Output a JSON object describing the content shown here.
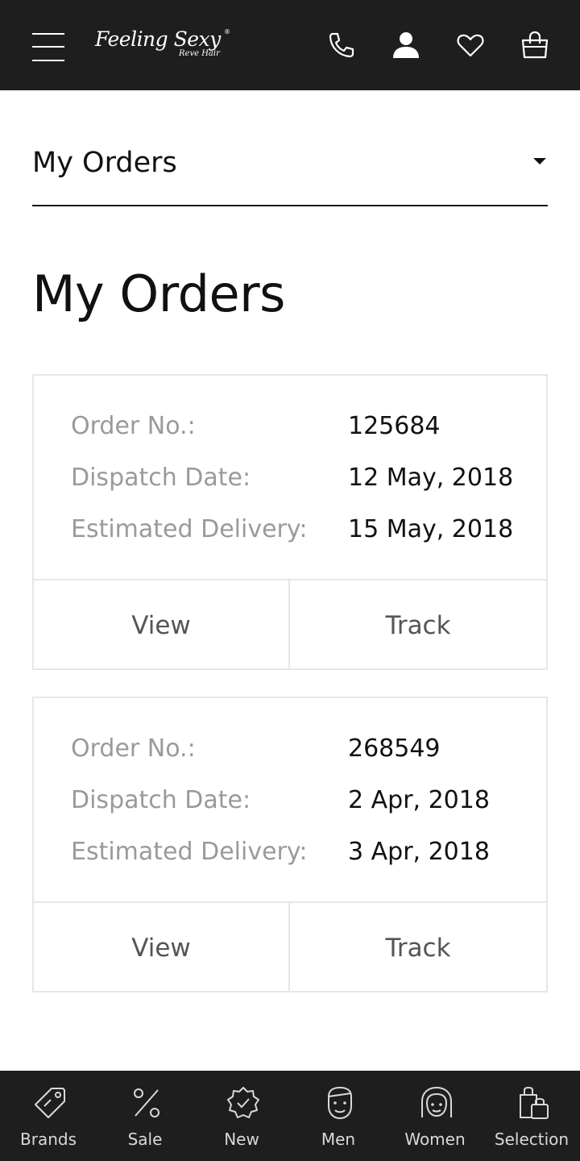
{
  "header": {
    "logo_text": "Feeling Sexy",
    "logo_subtext": "Reve Hair",
    "logo_mark": "®",
    "icons": [
      "menu-icon",
      "phone-icon",
      "user-icon",
      "heart-icon",
      "bag-icon"
    ]
  },
  "dropdown": {
    "label": "My Orders"
  },
  "page": {
    "title": "My Orders"
  },
  "orders": [
    {
      "order_no_label": "Order No.:",
      "order_no": "125684",
      "dispatch_label": "Dispatch Date:",
      "dispatch_date": "12 May, 2018",
      "delivery_label": "Estimated Delivery:",
      "delivery_date": "15 May, 2018",
      "view_label": "View",
      "track_label": "Track"
    },
    {
      "order_no_label": "Order No.:",
      "order_no": "268549",
      "dispatch_label": "Dispatch Date:",
      "dispatch_date": "2 Apr, 2018",
      "delivery_label": "Estimated Delivery:",
      "delivery_date": "3 Apr, 2018",
      "view_label": "View",
      "track_label": "Track"
    }
  ],
  "bottom_nav": [
    {
      "label": "Brands",
      "icon": "tag-icon"
    },
    {
      "label": "Sale",
      "icon": "percent-icon"
    },
    {
      "label": "New",
      "icon": "badge-check-icon"
    },
    {
      "label": "Men",
      "icon": "man-face-icon"
    },
    {
      "label": "Women",
      "icon": "woman-face-icon"
    },
    {
      "label": "Selection",
      "icon": "shopping-bag-icon"
    }
  ],
  "colors": {
    "header_bg": "#1e1e1e",
    "label_gray": "#9a9a9a",
    "border": "#e6e6e6"
  }
}
